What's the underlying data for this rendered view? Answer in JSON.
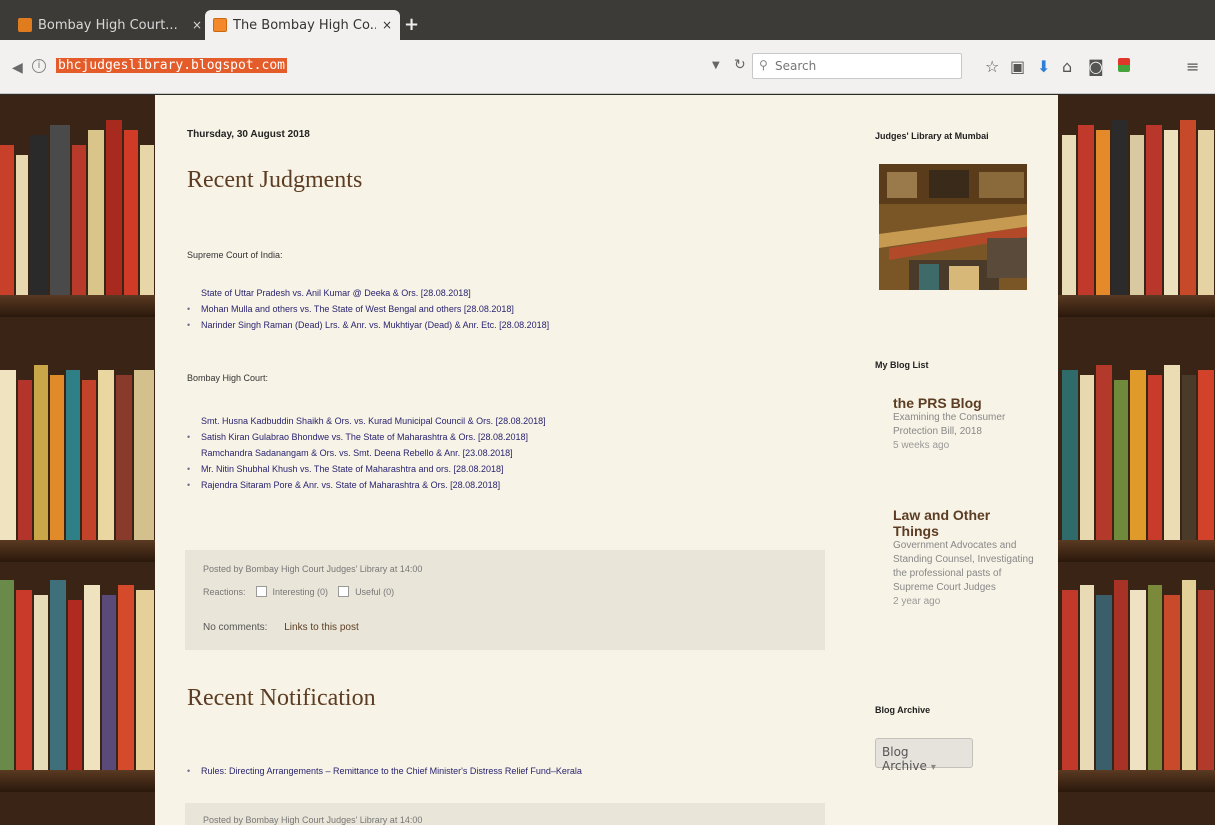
{
  "browser": {
    "tabs": [
      {
        "title": "Bombay High Court...",
        "active": false,
        "close": "×"
      },
      {
        "title": "The Bombay High Co...",
        "active": true,
        "close": "×"
      }
    ],
    "new_tab": "+",
    "url": "bhcjudgeslibrary.blogspot.com",
    "search_placeholder": "Search",
    "icons": [
      "back-icon",
      "info-icon",
      "reload-icon",
      "search-icon",
      "star-icon",
      "clipboard-icon",
      "download-icon",
      "home-icon",
      "pocket-icon",
      "extension-icon",
      "menu-icon"
    ]
  },
  "post1": {
    "date": "Thursday, 30 August 2018",
    "title": "Recent Judgments",
    "section_sc": "Supreme Court of India:",
    "sc_items": [
      "State of Uttar Pradesh vs. Anil Kumar @ Deeka & Ors. [28.08.2018]",
      "Mohan Mulla and others vs. The State of West Bengal and others [28.08.2018]",
      "Narinder Singh Raman (Dead) Lrs. & Anr. vs. Mukhtiyar (Dead) & Anr. Etc. [28.08.2018]"
    ],
    "section_hc": "Bombay High Court:",
    "hc_items": [
      "Smt. Husna Kadbuddin Shaikh & Ors. vs. Kurad Municipal Council & Ors. [28.08.2018]",
      "Satish Kiran Gulabrao Bhondwe vs. The State of Maharashtra & Ors. [28.08.2018]",
      "Ramchandra Sadanangam & Ors. vs. Smt. Deena Rebello & Anr. [23.08.2018]",
      "Mr. Nitin Shubhal Khush vs. The State of Maharashtra and ors. [28.08.2018]",
      "Rajendra Sitaram Pore & Anr. vs. State of Maharashtra & Ors. [28.08.2018]"
    ],
    "posted_by": "Posted by Bombay High Court Judges' Library at 14:00",
    "reactions_label": "Reactions:",
    "reaction_1": "Interesting (0)",
    "reaction_2": "Useful (0)",
    "comments": "No comments:",
    "link_label": "Links to this post"
  },
  "post2": {
    "title": "Recent Notification",
    "items": [
      "Rules: Directing Arrangements – Remittance to the Chief Minister's Distress Relief Fund–Kerala"
    ],
    "posted_by": "Posted by Bombay High Court Judges' Library at 14:00"
  },
  "sidebar": {
    "library_title": "Judges' Library at Mumbai",
    "bloglist_title": "My Blog List",
    "blogs": [
      {
        "name": "the PRS Blog",
        "snippet": "Examining the Consumer Protection Bill, 2018",
        "age": "5 weeks ago"
      },
      {
        "name": "Law and Other Things",
        "snippet": "Government Advocates and Standing Counsel, Investigating the professional pasts of Supreme Court Judges",
        "age": "2 year ago"
      }
    ],
    "archive_title": "Blog Archive",
    "archive_select": "Blog Archive",
    "archive_caret": "▾"
  }
}
